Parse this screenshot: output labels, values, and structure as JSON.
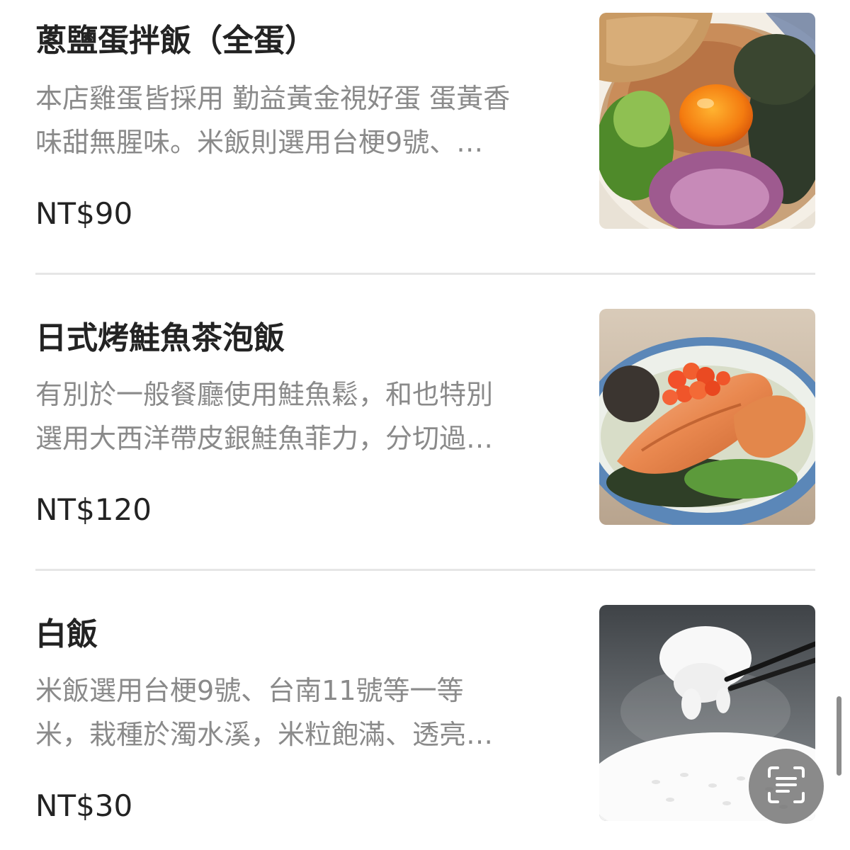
{
  "menu": {
    "items": [
      {
        "title": "蔥鹽蛋拌飯（全蛋）",
        "description_lines": [
          "本店雞蛋皆採用 勤益黃金視好蛋 蛋黃香",
          "味甜無腥味。米飯則選用台梗9號、…"
        ],
        "price": "NT$90",
        "image": "egg-rice-bowl-image"
      },
      {
        "title": "日式烤鮭魚茶泡飯",
        "description_lines": [
          "有別於一般餐廳使用鮭魚鬆，和也特別",
          "選用大西洋帶皮銀鮭魚菲力，分切過…"
        ],
        "price": "NT$120",
        "image": "salmon-chazuke-image"
      },
      {
        "title": "白飯",
        "description_lines": [
          "米飯選用台梗9號、台南11號等一等",
          "米，栽種於濁水溪，米粒飽滿、透亮…"
        ],
        "price": "NT$30",
        "image": "white-rice-image"
      }
    ]
  },
  "scan_button": {
    "icon": "text-scan-icon"
  },
  "colors": {
    "title": "#232323",
    "description": "#8a8a8a",
    "price": "#232323",
    "divider": "#e6e6e6"
  }
}
